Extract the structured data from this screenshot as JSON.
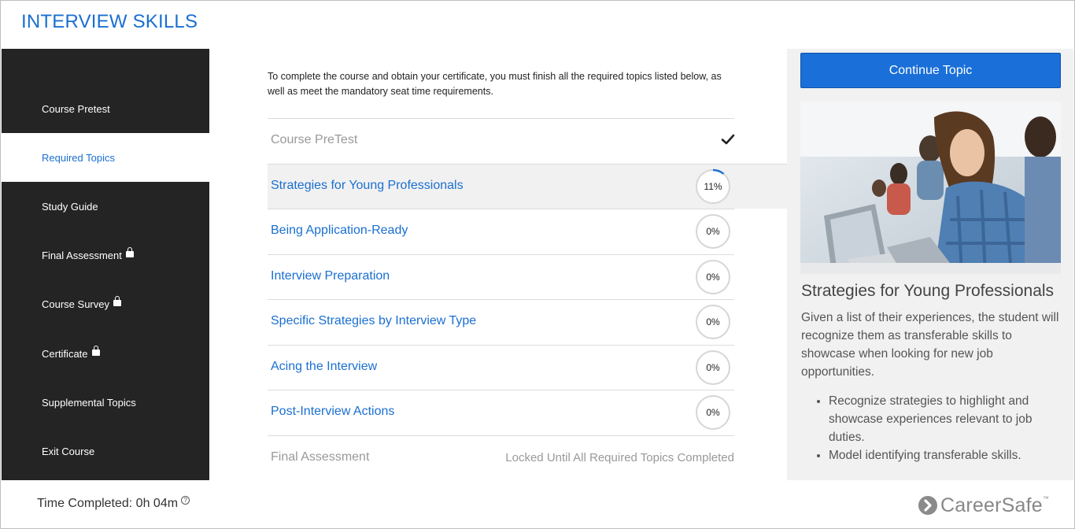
{
  "app": {
    "title": "INTERVIEW SKILLS"
  },
  "sidebar": {
    "items": [
      {
        "label": "Course Pretest",
        "locked": false,
        "active": false
      },
      {
        "label": "Required Topics",
        "locked": false,
        "active": true
      },
      {
        "label": "Study Guide",
        "locked": false,
        "active": false
      },
      {
        "label": "Final Assessment",
        "locked": true,
        "active": false
      },
      {
        "label": "Course Survey",
        "locked": true,
        "active": false
      },
      {
        "label": "Certificate",
        "locked": true,
        "active": false
      },
      {
        "label": "Supplemental Topics",
        "locked": false,
        "active": false
      },
      {
        "label": "Exit Course",
        "locked": false,
        "active": false
      }
    ],
    "time_completed": "Time Completed: 0h 04m",
    "help_glyph": "?"
  },
  "main": {
    "intro": "To complete the course and obtain your certificate, you must finish all the required topics listed below, as well as meet the mandatory seat time requirements.",
    "topics": [
      {
        "label": "Course PreTest",
        "status": "complete",
        "progress": 1.0
      },
      {
        "label": "Strategies for Young Professionals",
        "status": "in-progress",
        "progress_text": "11%",
        "progress": 0.11
      },
      {
        "label": "Being Application-Ready",
        "status": "not-started",
        "progress_text": "0%",
        "progress": 0
      },
      {
        "label": "Interview Preparation",
        "status": "not-started",
        "progress_text": "0%",
        "progress": 0
      },
      {
        "label": "Specific Strategies by Interview Type",
        "status": "not-started",
        "progress_text": "0%",
        "progress": 0
      },
      {
        "label": "Acing the Interview",
        "status": "not-started",
        "progress_text": "0%",
        "progress": 0
      },
      {
        "label": "Post-Interview Actions",
        "status": "not-started",
        "progress_text": "0%",
        "progress": 0
      },
      {
        "label": "Final Assessment",
        "status": "locked",
        "locked_text": "Locked Until All Required Topics Completed"
      }
    ]
  },
  "panel": {
    "button_label": "Continue Topic",
    "title": "Strategies for Young Professionals",
    "description": "Given a list of their experiences, the student will recognize them as transferable skills to showcase when looking for new job opportunities.",
    "bullets": [
      "Recognize strategies to highlight and showcase experiences relevant to job duties.",
      "Model identifying transferable skills."
    ]
  },
  "footer": {
    "logo_text": "CareerSafe",
    "logo_tm": "™"
  },
  "colors": {
    "accent": "#1a6fd1",
    "button": "#1a6fd8",
    "sidebar_bg": "#242424",
    "panel_bg": "#f1f1f1",
    "muted_text": "#999999"
  },
  "icons": {
    "lock": "lock-icon",
    "check": "check-icon",
    "help": "help-icon",
    "logo": "careersafe-logo-icon"
  }
}
